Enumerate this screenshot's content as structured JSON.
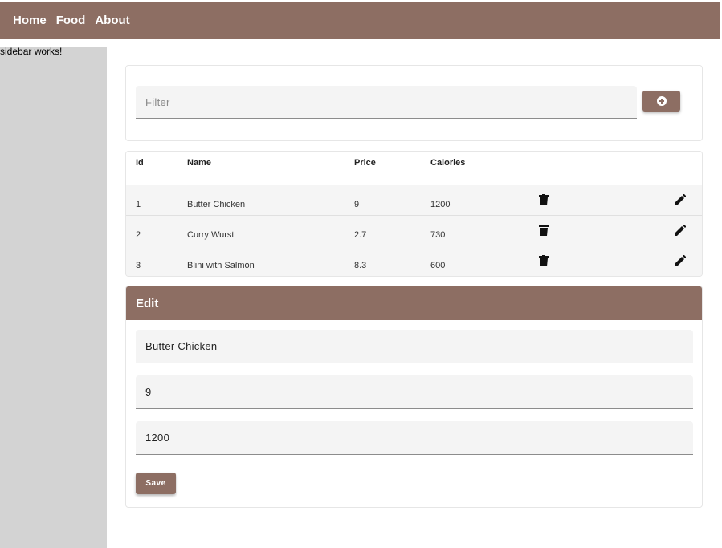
{
  "nav": {
    "items": [
      "Home",
      "Food",
      "About"
    ]
  },
  "sidebar": {
    "text": "sidebar works!"
  },
  "filter": {
    "placeholder": "Filter",
    "add_icon": "add-circle-icon"
  },
  "table": {
    "headers": {
      "id": "Id",
      "name": "Name",
      "price": "Price",
      "calories": "Calories"
    },
    "rows": [
      {
        "id": "1",
        "name": "Butter Chicken",
        "price": "9",
        "calories": "1200"
      },
      {
        "id": "2",
        "name": "Curry Wurst",
        "price": "2.7",
        "calories": "730"
      },
      {
        "id": "3",
        "name": "Blini with Salmon",
        "price": "8.3",
        "calories": "600"
      }
    ],
    "delete_icon": "trash-icon",
    "edit_icon": "pencil-icon"
  },
  "edit": {
    "title": "Edit",
    "name_value": "Butter Chicken",
    "price_value": "9",
    "calories_value": "1200",
    "save_label": "Save"
  },
  "colors": {
    "primary": "#8d6e63",
    "sidebar": "#d3d3d3",
    "field": "#f4f4f4"
  }
}
